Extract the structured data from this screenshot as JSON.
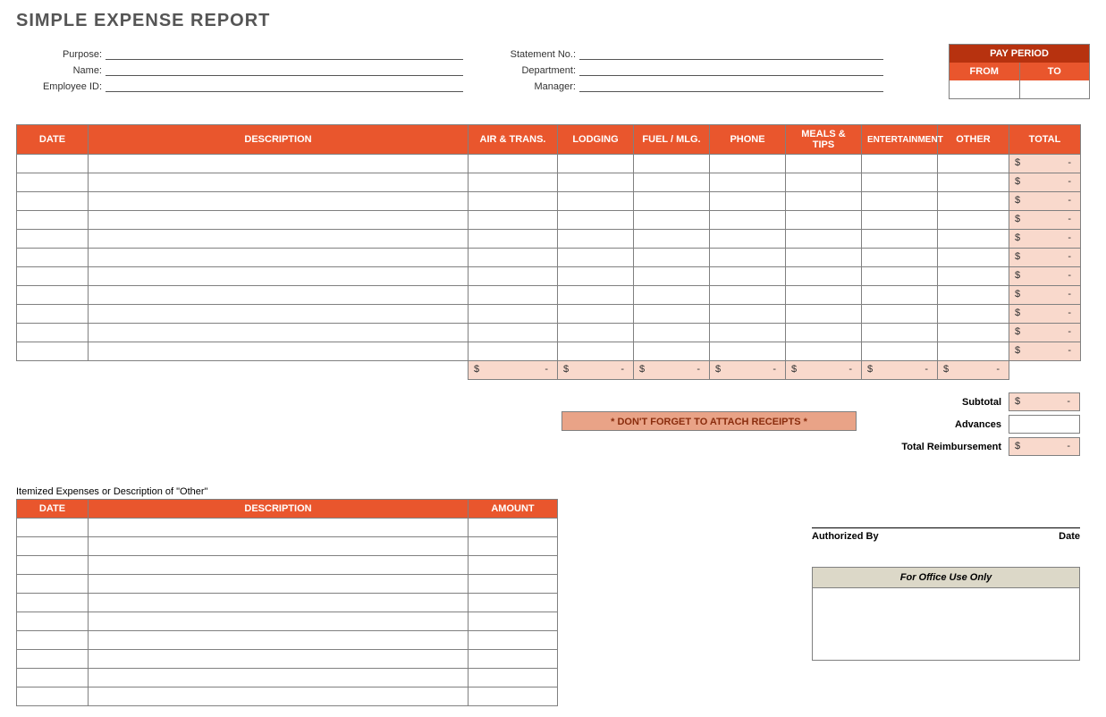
{
  "title": "SIMPLE EXPENSE REPORT",
  "info": {
    "purpose_label": "Purpose:",
    "name_label": "Name:",
    "employee_id_label": "Employee ID:",
    "statement_no_label": "Statement No.:",
    "department_label": "Department:",
    "manager_label": "Manager:"
  },
  "pay_period": {
    "title": "PAY PERIOD",
    "from": "FROM",
    "to": "TO"
  },
  "main_headers": {
    "date": "DATE",
    "description": "DESCRIPTION",
    "air": "AIR & TRANS.",
    "lodging": "LODGING",
    "fuel": "FUEL / MLG.",
    "phone": "PHONE",
    "meals": "MEALS & TIPS",
    "entertainment": "ENTERTAINMENT",
    "other": "OTHER",
    "total": "TOTAL"
  },
  "currency": "$",
  "dash": "-",
  "receipts_note": "* DON'T FORGET TO ATTACH RECEIPTS *",
  "summary": {
    "subtotal": "Subtotal",
    "advances": "Advances",
    "total_reimbursement": "Total Reimbursement"
  },
  "itemized": {
    "title": "Itemized Expenses or Description of \"Other\"",
    "date": "DATE",
    "description": "DESCRIPTION",
    "amount": "AMOUNT"
  },
  "auth": {
    "authorized_by": "Authorized By",
    "date": "Date"
  },
  "office": {
    "header": "For Office Use Only"
  }
}
